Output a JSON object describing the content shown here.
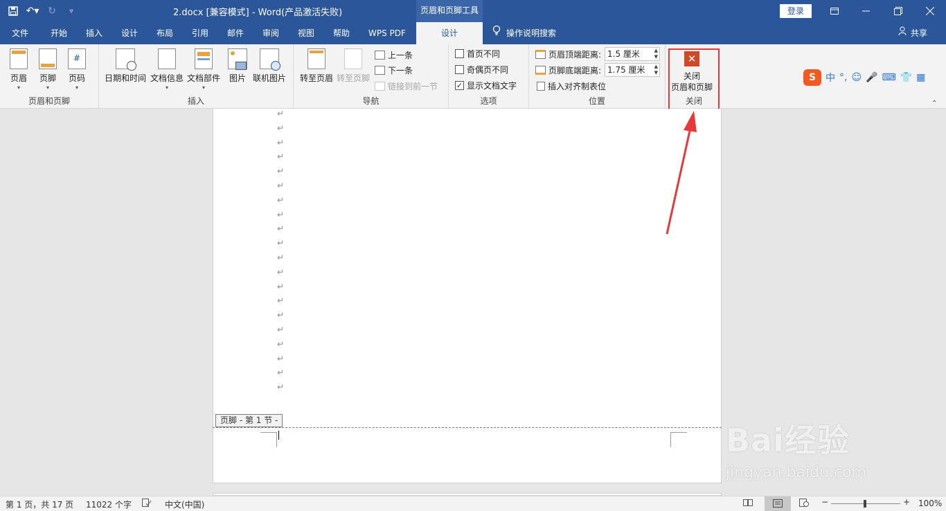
{
  "title_bar": {
    "doc_title": "2.docx [兼容模式]  -  Word(产品激活失败)",
    "context_tab_title": "页眉和页脚工具",
    "login": "登录",
    "window_controls": [
      "ribbon-display-icon",
      "minimize-icon",
      "restore-icon",
      "close-icon"
    ]
  },
  "tabs": [
    "文件",
    "开始",
    "插入",
    "设计",
    "布局",
    "引用",
    "邮件",
    "审阅",
    "视图",
    "帮助",
    "WPS PDF",
    "设计"
  ],
  "active_tab": "设计",
  "tell_me": "操作说明搜索",
  "share": "共享",
  "ribbon": {
    "group_header_footer": {
      "label": "页眉和页脚",
      "buttons": [
        "页眉",
        "页脚",
        "页码"
      ]
    },
    "group_insert": {
      "label": "插入",
      "buttons": [
        "日期和时间",
        "文档信息",
        "文档部件",
        "图片",
        "联机图片"
      ]
    },
    "group_nav": {
      "label": "导航",
      "goto_header": "转至页眉",
      "goto_footer": "转至页脚",
      "prev": "上一条",
      "next": "下一条",
      "link_prev": "链接到前一节"
    },
    "group_options": {
      "label": "选项",
      "first_page": "首页不同",
      "odd_even": "奇偶页不同",
      "show_text": "显示文档文字",
      "show_text_checked": "✓"
    },
    "group_position": {
      "label": "位置",
      "header_top": "页眉顶端距离:",
      "header_top_value": "1.5 厘米",
      "footer_bottom": "页脚底端距离:",
      "footer_bottom_value": "1.75 厘米",
      "insert_tab": "插入对齐制表位"
    },
    "group_close": {
      "label": "关闭",
      "button_line1": "关闭",
      "button_line2": "页眉和页脚",
      "x": "✕"
    }
  },
  "ime": {
    "logo": "S",
    "items": [
      "中",
      "°,",
      "☺",
      "🎤",
      "⌨",
      "👕",
      "▦"
    ]
  },
  "document": {
    "para_mark": "↵",
    "footer_tag": "页脚 - 第 1 节 -"
  },
  "watermark": {
    "big": "Bai经验",
    "small": "jingyan.baidu.com"
  },
  "status": {
    "page": "第 1 页，共 17 页",
    "words": "11022 个字",
    "lang": "中文(中国)",
    "zoom": "100%",
    "zoom_minus": "−",
    "zoom_plus": "+"
  },
  "colors": {
    "accent": "#2b579a",
    "highlight": "#e8393a",
    "close_icon": "#d24726"
  }
}
